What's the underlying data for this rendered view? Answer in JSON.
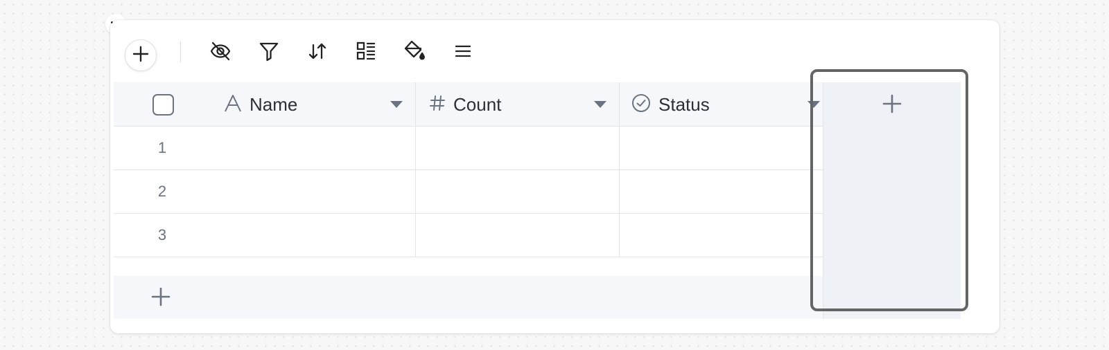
{
  "toolbar": {
    "add_icon": "plus-icon",
    "tools": [
      {
        "name": "hide-fields-icon"
      },
      {
        "name": "filter-icon"
      },
      {
        "name": "sort-icon"
      },
      {
        "name": "group-icon"
      },
      {
        "name": "color-icon"
      },
      {
        "name": "row-height-icon"
      }
    ]
  },
  "columns": [
    {
      "label": "Name",
      "icon": "text-type-icon"
    },
    {
      "label": "Count",
      "icon": "number-type-icon"
    },
    {
      "label": "Status",
      "icon": "status-type-icon"
    }
  ],
  "rows": [
    {
      "num": "1"
    },
    {
      "num": "2"
    },
    {
      "num": "3"
    }
  ],
  "colors": {
    "header_bg": "#f5f7fa",
    "add_column_bg": "#eef1f5",
    "highlight_border": "#636567",
    "icon": "#6b7280"
  }
}
